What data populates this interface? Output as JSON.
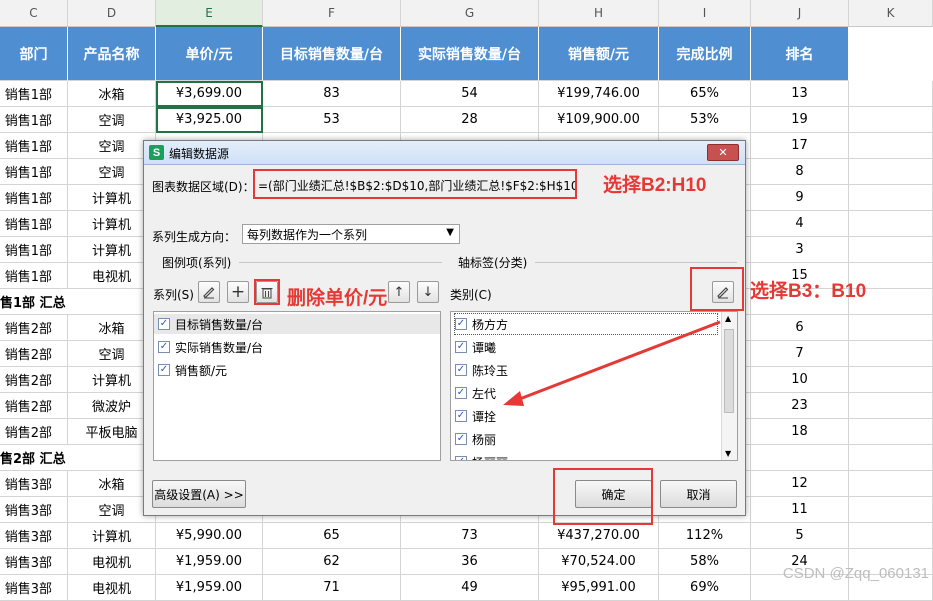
{
  "columns": [
    "C",
    "D",
    "E",
    "F",
    "G",
    "H",
    "I",
    "J",
    "K"
  ],
  "header": [
    "部门",
    "产品名称",
    "单价/元",
    "目标销售数量/台",
    "实际销售数量/台",
    "销售额/元",
    "完成比例",
    "排名"
  ],
  "rows": [
    {
      "dept": "销售1部",
      "product": "冰箱",
      "price": "¥3,699.00",
      "target": "83",
      "actual": "54",
      "sales": "¥199,746.00",
      "ratio": "65%",
      "rank": "13"
    },
    {
      "dept": "销售1部",
      "product": "空调",
      "price": "¥3,925.00",
      "target": "53",
      "actual": "28",
      "sales": "¥109,900.00",
      "ratio": "53%",
      "rank": "19"
    },
    {
      "dept": "销售1部",
      "product": "空调",
      "rank": "17"
    },
    {
      "dept": "销售1部",
      "product": "空调",
      "rank": "8"
    },
    {
      "dept": "销售1部",
      "product": "计算机",
      "rank": "9"
    },
    {
      "dept": "销售1部",
      "product": "计算机",
      "rank": "4"
    },
    {
      "dept": "销售1部",
      "product": "计算机",
      "rank": "3"
    },
    {
      "dept": "销售1部",
      "product": "电视机",
      "rank": "15"
    },
    {
      "dept": "售1部 汇总",
      "subtotal": true
    },
    {
      "dept": "销售2部",
      "product": "冰箱",
      "rank": "6"
    },
    {
      "dept": "销售2部",
      "product": "空调",
      "rank": "7"
    },
    {
      "dept": "销售2部",
      "product": "计算机",
      "rank": "10"
    },
    {
      "dept": "销售2部",
      "product": "微波炉",
      "rank": "23"
    },
    {
      "dept": "销售2部",
      "product": "平板电脑",
      "rank": "18"
    },
    {
      "dept": "售2部 汇总",
      "subtotal": true
    },
    {
      "dept": "销售3部",
      "product": "冰箱",
      "rank": "12"
    },
    {
      "dept": "销售3部",
      "product": "空调",
      "rank": "11"
    },
    {
      "dept": "销售3部",
      "product": "计算机",
      "price": "¥5,990.00",
      "target": "65",
      "actual": "73",
      "sales": "¥437,270.00",
      "ratio": "112%",
      "rank": "5"
    },
    {
      "dept": "销售3部",
      "product": "电视机",
      "price": "¥1,959.00",
      "target": "62",
      "actual": "36",
      "sales": "¥70,524.00",
      "ratio": "58%",
      "rank": "24"
    },
    {
      "dept": "销售3部",
      "product": "电视机",
      "price": "¥1,959.00",
      "target": "71",
      "actual": "49",
      "sales": "¥95,991.00",
      "ratio": "69%",
      "rank": ""
    }
  ],
  "dialog": {
    "title": "编辑数据源",
    "close": "✕",
    "data_range_label": "图表数据区域(D)：",
    "data_range_value": "=(部门业绩汇总!$B$2:$D$10,部门业绩汇总!$F$2:$H$10)",
    "direction_label": "系列生成方向：",
    "direction_value": "每列数据作为一个系列",
    "legend_group": "图例项(系列)",
    "series_label": "系列(S)",
    "axis_group": "轴标签(分类)",
    "category_label": "类别(C)",
    "series_items": [
      "目标销售数量/台",
      "实际销售数量/台",
      "销售额/元"
    ],
    "category_items": [
      "杨方方",
      "谭曦",
      "陈玲玉",
      "左代",
      "谭拴",
      "杨丽",
      "杨丽丽"
    ],
    "advanced": "高级设置(A) >>",
    "ok": "确定",
    "cancel": "取消"
  },
  "annotations": {
    "select_range": "选择B2:H10",
    "delete_price": "删除单价/元",
    "select_category": "选择B3：B10"
  },
  "watermark": "CSDN @Zqq_060131",
  "colors": {
    "header_blue": "#4f8fd1",
    "annotation_red": "#e53935",
    "selected_green": "#217346"
  }
}
